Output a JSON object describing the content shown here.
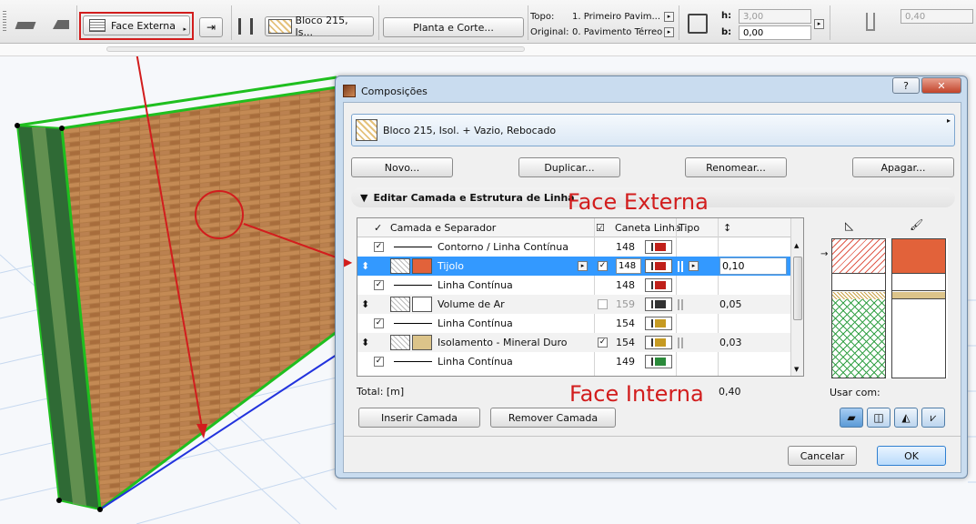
{
  "toolbar": {
    "face_button_label": "Face Externa",
    "composite_label": "Bloco 215, Is...",
    "plan_button_label": "Planta e Corte...",
    "topo_label": "Topo:",
    "topo_value": "1. Primeiro Pavim...",
    "original_label": "Original:",
    "original_value": "0. Pavimento Térreo",
    "h_label": "h:",
    "h_value": "3,00",
    "b_label": "b:",
    "b_value": "0,00",
    "thickness_value": "0,40"
  },
  "dialog": {
    "title": "Composições",
    "help_label": "?",
    "close_label": "✕",
    "composite_name": "Bloco 215, Isol. + Vazio, Rebocado",
    "buttons": {
      "new": "Novo...",
      "duplicate": "Duplicar...",
      "rename": "Renomear...",
      "delete": "Apagar..."
    },
    "section_title": "Editar Camada e Estrutura de Linha",
    "columns": {
      "layer": "Camada e Separador",
      "pen": "Caneta Linha",
      "type": "Tipo"
    },
    "rows": [
      {
        "name": "Contorno / Linha Contínua",
        "kind": "line",
        "checked": true,
        "pen": "148",
        "pen_color": "#c0201a",
        "thickness": ""
      },
      {
        "name": "Tijolo",
        "kind": "layer",
        "checked": true,
        "pen": "148",
        "pen_color": "#c0201a",
        "thickness": "0,10",
        "fill_color": "#e2623a"
      },
      {
        "name": "Linha Contínua",
        "kind": "line",
        "checked": true,
        "pen": "148",
        "pen_color": "#c0201a",
        "thickness": ""
      },
      {
        "name": "Volume de Ar",
        "kind": "layer",
        "checked": false,
        "pen": "159",
        "pen_color": "#333333",
        "thickness": "0,05",
        "fill_color": "#ffffff"
      },
      {
        "name": "Linha Contínua",
        "kind": "line",
        "checked": true,
        "pen": "154",
        "pen_color": "#c69a22",
        "thickness": ""
      },
      {
        "name": "Isolamento - Mineral Duro",
        "kind": "layer",
        "checked": true,
        "pen": "154",
        "pen_color": "#c69a22",
        "thickness": "0,03",
        "fill_color": "#dcc48a"
      },
      {
        "name": "Linha Contínua",
        "kind": "line",
        "checked": true,
        "pen": "149",
        "pen_color": "#2a8a3a",
        "thickness": ""
      }
    ],
    "total_label": "Total: [m]",
    "total_value": "0,40",
    "insert_label": "Inserir Camada",
    "remove_label": "Remover Camada",
    "use_with_label": "Usar com:",
    "cancel_label": "Cancelar",
    "ok_label": "OK"
  },
  "annotations": {
    "face_externa": "Face Externa",
    "face_interna": "Face Interna"
  },
  "colors": {
    "brick": "#b7743f",
    "annotation_red": "#d21d1d",
    "wall_green": "#1f9f1f",
    "selection_blue": "#3399ff"
  }
}
